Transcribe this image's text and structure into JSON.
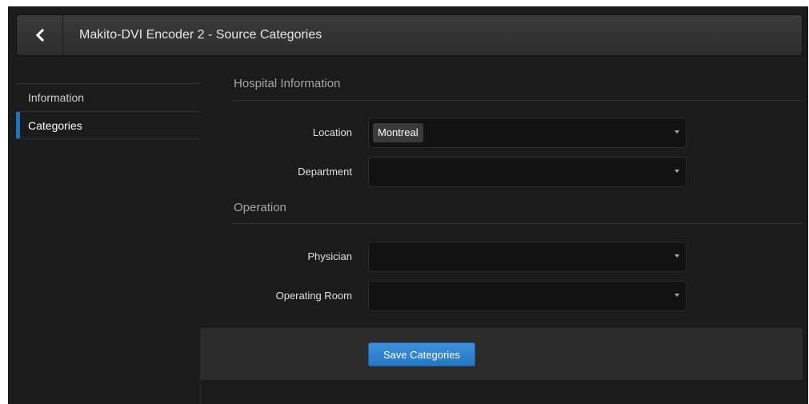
{
  "header": {
    "back_icon": "chevron-left-icon",
    "title": "Makito-DVI Encoder 2 - Source Categories"
  },
  "sidebar": {
    "items": [
      {
        "label": "Information",
        "active": false
      },
      {
        "label": "Categories",
        "active": true
      }
    ],
    "accent_color": "#1e73be"
  },
  "sections": {
    "hospital": {
      "title": "Hospital Information",
      "location_label": "Location",
      "location_value": "Montreal",
      "department_label": "Department",
      "department_value": ""
    },
    "operation": {
      "title": "Operation",
      "physician_label": "Physician",
      "physician_value": "",
      "operating_room_label": "Operating Room",
      "operating_room_value": ""
    }
  },
  "footer": {
    "save_label": "Save Categories",
    "button_color": "#2f84d0"
  }
}
